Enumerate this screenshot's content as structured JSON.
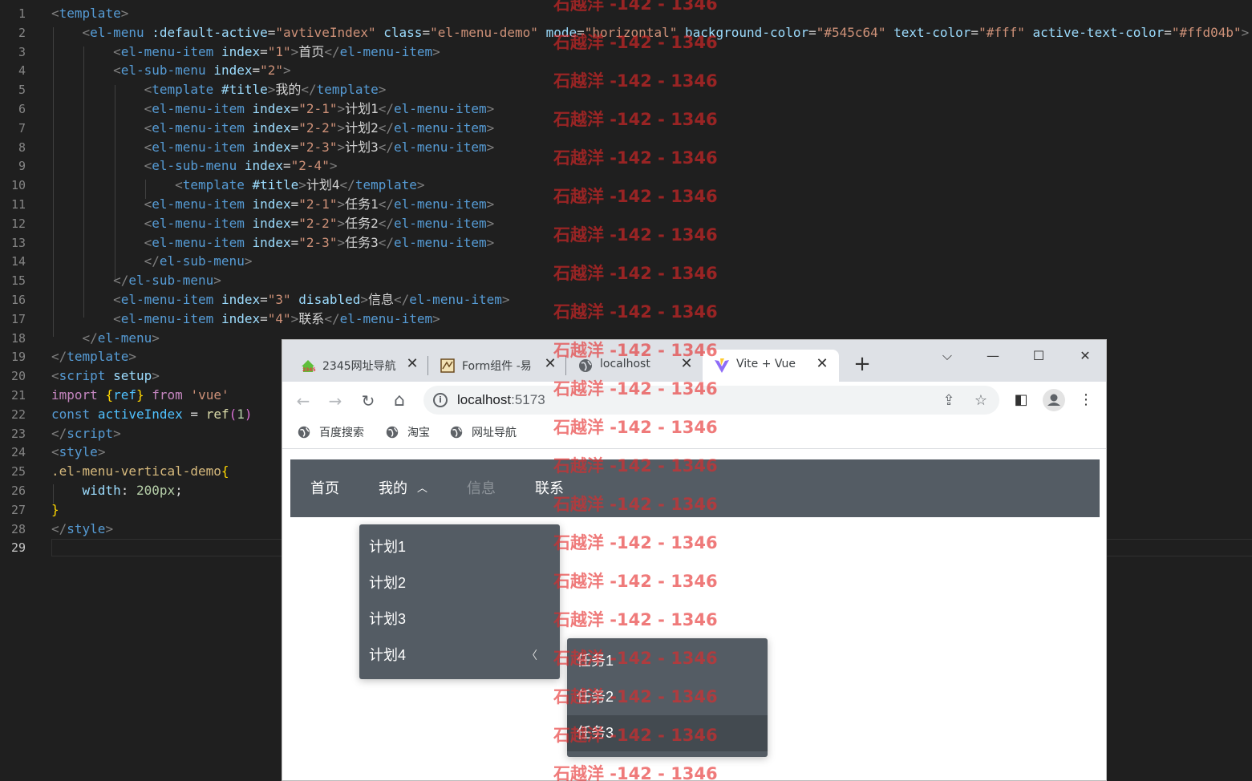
{
  "editor": {
    "lines": [
      [
        [
          "t-br",
          "<"
        ],
        [
          "t-tag",
          "template"
        ],
        [
          "t-br",
          ">"
        ]
      ],
      [
        [
          "t-txt",
          "    "
        ],
        [
          "t-br",
          "<"
        ],
        [
          "t-tag",
          "el-menu"
        ],
        [
          "t-txt",
          " "
        ],
        [
          "t-attr",
          ":default-active"
        ],
        [
          "t-txt",
          "="
        ],
        [
          "t-str",
          "\"avtiveIndex\""
        ],
        [
          "t-txt",
          " "
        ],
        [
          "t-attr",
          "class"
        ],
        [
          "t-txt",
          "="
        ],
        [
          "t-str",
          "\"el-menu-demo\""
        ],
        [
          "t-txt",
          " "
        ],
        [
          "t-attr",
          "mode"
        ],
        [
          "t-txt",
          "="
        ],
        [
          "t-str",
          "\"horizontal\""
        ],
        [
          "t-txt",
          " "
        ],
        [
          "t-attr",
          "background-color"
        ],
        [
          "t-txt",
          "="
        ],
        [
          "t-str",
          "\"#545c64\""
        ],
        [
          "t-txt",
          " "
        ],
        [
          "t-attr",
          "text-color"
        ],
        [
          "t-txt",
          "="
        ],
        [
          "t-str",
          "\"#fff\""
        ],
        [
          "t-txt",
          " "
        ],
        [
          "t-attr",
          "active-text-color"
        ],
        [
          "t-txt",
          "="
        ],
        [
          "t-str",
          "\"#ffd04b\""
        ],
        [
          "t-br",
          ">"
        ]
      ],
      [
        [
          "t-txt",
          "        "
        ],
        [
          "t-br",
          "<"
        ],
        [
          "t-tag",
          "el-menu-item"
        ],
        [
          "t-txt",
          " "
        ],
        [
          "t-attr",
          "index"
        ],
        [
          "t-txt",
          "="
        ],
        [
          "t-str",
          "\"1\""
        ],
        [
          "t-br",
          ">"
        ],
        [
          "t-txt",
          "首页"
        ],
        [
          "t-br",
          "</"
        ],
        [
          "t-tag",
          "el-menu-item"
        ],
        [
          "t-br",
          ">"
        ]
      ],
      [
        [
          "t-txt",
          "        "
        ],
        [
          "t-br",
          "<"
        ],
        [
          "t-tag",
          "el-sub-menu"
        ],
        [
          "t-txt",
          " "
        ],
        [
          "t-attr",
          "index"
        ],
        [
          "t-txt",
          "="
        ],
        [
          "t-str",
          "\"2\""
        ],
        [
          "t-br",
          ">"
        ]
      ],
      [
        [
          "t-txt",
          "            "
        ],
        [
          "t-br",
          "<"
        ],
        [
          "t-tag",
          "template"
        ],
        [
          "t-txt",
          " "
        ],
        [
          "t-attr",
          "#title"
        ],
        [
          "t-br",
          ">"
        ],
        [
          "t-txt",
          "我的"
        ],
        [
          "t-br",
          "</"
        ],
        [
          "t-tag",
          "template"
        ],
        [
          "t-br",
          ">"
        ]
      ],
      [
        [
          "t-txt",
          "            "
        ],
        [
          "t-br",
          "<"
        ],
        [
          "t-tag",
          "el-menu-item"
        ],
        [
          "t-txt",
          " "
        ],
        [
          "t-attr",
          "index"
        ],
        [
          "t-txt",
          "="
        ],
        [
          "t-str",
          "\"2-1\""
        ],
        [
          "t-br",
          ">"
        ],
        [
          "t-txt",
          "计划1"
        ],
        [
          "t-br",
          "</"
        ],
        [
          "t-tag",
          "el-menu-item"
        ],
        [
          "t-br",
          ">"
        ]
      ],
      [
        [
          "t-txt",
          "            "
        ],
        [
          "t-br",
          "<"
        ],
        [
          "t-tag",
          "el-menu-item"
        ],
        [
          "t-txt",
          " "
        ],
        [
          "t-attr",
          "index"
        ],
        [
          "t-txt",
          "="
        ],
        [
          "t-str",
          "\"2-2\""
        ],
        [
          "t-br",
          ">"
        ],
        [
          "t-txt",
          "计划2"
        ],
        [
          "t-br",
          "</"
        ],
        [
          "t-tag",
          "el-menu-item"
        ],
        [
          "t-br",
          ">"
        ]
      ],
      [
        [
          "t-txt",
          "            "
        ],
        [
          "t-br",
          "<"
        ],
        [
          "t-tag",
          "el-menu-item"
        ],
        [
          "t-txt",
          " "
        ],
        [
          "t-attr",
          "index"
        ],
        [
          "t-txt",
          "="
        ],
        [
          "t-str",
          "\"2-3\""
        ],
        [
          "t-br",
          ">"
        ],
        [
          "t-txt",
          "计划3"
        ],
        [
          "t-br",
          "</"
        ],
        [
          "t-tag",
          "el-menu-item"
        ],
        [
          "t-br",
          ">"
        ]
      ],
      [
        [
          "t-txt",
          "            "
        ],
        [
          "t-br",
          "<"
        ],
        [
          "t-tag",
          "el-sub-menu"
        ],
        [
          "t-txt",
          " "
        ],
        [
          "t-attr",
          "index"
        ],
        [
          "t-txt",
          "="
        ],
        [
          "t-str",
          "\"2-4\""
        ],
        [
          "t-br",
          ">"
        ]
      ],
      [
        [
          "t-txt",
          "                "
        ],
        [
          "t-br",
          "<"
        ],
        [
          "t-tag",
          "template"
        ],
        [
          "t-txt",
          " "
        ],
        [
          "t-attr",
          "#title"
        ],
        [
          "t-br",
          ">"
        ],
        [
          "t-txt",
          "计划4"
        ],
        [
          "t-br",
          "</"
        ],
        [
          "t-tag",
          "template"
        ],
        [
          "t-br",
          ">"
        ]
      ],
      [
        [
          "t-txt",
          "            "
        ],
        [
          "t-br",
          "<"
        ],
        [
          "t-tag",
          "el-menu-item"
        ],
        [
          "t-txt",
          " "
        ],
        [
          "t-attr",
          "index"
        ],
        [
          "t-txt",
          "="
        ],
        [
          "t-str",
          "\"2-1\""
        ],
        [
          "t-br",
          ">"
        ],
        [
          "t-txt",
          "任务1"
        ],
        [
          "t-br",
          "</"
        ],
        [
          "t-tag",
          "el-menu-item"
        ],
        [
          "t-br",
          ">"
        ]
      ],
      [
        [
          "t-txt",
          "            "
        ],
        [
          "t-br",
          "<"
        ],
        [
          "t-tag",
          "el-menu-item"
        ],
        [
          "t-txt",
          " "
        ],
        [
          "t-attr",
          "index"
        ],
        [
          "t-txt",
          "="
        ],
        [
          "t-str",
          "\"2-2\""
        ],
        [
          "t-br",
          ">"
        ],
        [
          "t-txt",
          "任务2"
        ],
        [
          "t-br",
          "</"
        ],
        [
          "t-tag",
          "el-menu-item"
        ],
        [
          "t-br",
          ">"
        ]
      ],
      [
        [
          "t-txt",
          "            "
        ],
        [
          "t-br",
          "<"
        ],
        [
          "t-tag",
          "el-menu-item"
        ],
        [
          "t-txt",
          " "
        ],
        [
          "t-attr",
          "index"
        ],
        [
          "t-txt",
          "="
        ],
        [
          "t-str",
          "\"2-3\""
        ],
        [
          "t-br",
          ">"
        ],
        [
          "t-txt",
          "任务3"
        ],
        [
          "t-br",
          "</"
        ],
        [
          "t-tag",
          "el-menu-item"
        ],
        [
          "t-br",
          ">"
        ]
      ],
      [
        [
          "t-txt",
          "            "
        ],
        [
          "t-br",
          "</"
        ],
        [
          "t-tag",
          "el-sub-menu"
        ],
        [
          "t-br",
          ">"
        ]
      ],
      [
        [
          "t-txt",
          "        "
        ],
        [
          "t-br",
          "</"
        ],
        [
          "t-tag",
          "el-sub-menu"
        ],
        [
          "t-br",
          ">"
        ]
      ],
      [
        [
          "t-txt",
          "        "
        ],
        [
          "t-br",
          "<"
        ],
        [
          "t-tag",
          "el-menu-item"
        ],
        [
          "t-txt",
          " "
        ],
        [
          "t-attr",
          "index"
        ],
        [
          "t-txt",
          "="
        ],
        [
          "t-str",
          "\"3\""
        ],
        [
          "t-txt",
          " "
        ],
        [
          "t-attr",
          "disabled"
        ],
        [
          "t-br",
          ">"
        ],
        [
          "t-txt",
          "信息"
        ],
        [
          "t-br",
          "</"
        ],
        [
          "t-tag",
          "el-menu-item"
        ],
        [
          "t-br",
          ">"
        ]
      ],
      [
        [
          "t-txt",
          "        "
        ],
        [
          "t-br",
          "<"
        ],
        [
          "t-tag",
          "el-menu-item"
        ],
        [
          "t-txt",
          " "
        ],
        [
          "t-attr",
          "index"
        ],
        [
          "t-txt",
          "="
        ],
        [
          "t-str",
          "\"4\""
        ],
        [
          "t-br",
          ">"
        ],
        [
          "t-txt",
          "联系"
        ],
        [
          "t-br",
          "</"
        ],
        [
          "t-tag",
          "el-menu-item"
        ],
        [
          "t-br",
          ">"
        ]
      ],
      [
        [
          "t-txt",
          "    "
        ],
        [
          "t-br",
          "</"
        ],
        [
          "t-tag",
          "el-menu"
        ],
        [
          "t-br",
          ">"
        ]
      ],
      [
        [
          "t-br",
          "</"
        ],
        [
          "t-tag",
          "template"
        ],
        [
          "t-br",
          ">"
        ]
      ],
      [
        [
          "t-br",
          "<"
        ],
        [
          "t-tag",
          "script"
        ],
        [
          "t-txt",
          " "
        ],
        [
          "t-attr",
          "setup"
        ],
        [
          "t-br",
          ">"
        ]
      ],
      [
        [
          "t-kw2",
          "import"
        ],
        [
          "t-txt",
          " "
        ],
        [
          "t-brace",
          "{"
        ],
        [
          "t-var",
          "ref"
        ],
        [
          "t-brace",
          "}"
        ],
        [
          "t-txt",
          " "
        ],
        [
          "t-kw2",
          "from"
        ],
        [
          "t-txt",
          " "
        ],
        [
          "t-str",
          "'vue'"
        ]
      ],
      [
        [
          "t-kw",
          "const"
        ],
        [
          "t-txt",
          " "
        ],
        [
          "t-var",
          "activeIndex"
        ],
        [
          "t-txt",
          " = "
        ],
        [
          "t-fn",
          "ref"
        ],
        [
          "t-paren",
          "("
        ],
        [
          "t-num",
          "1"
        ],
        [
          "t-paren",
          ")"
        ]
      ],
      [
        [
          "t-br",
          "</"
        ],
        [
          "t-tag",
          "script"
        ],
        [
          "t-br",
          ">"
        ]
      ],
      [
        [
          "t-br",
          "<"
        ],
        [
          "t-tag",
          "style"
        ],
        [
          "t-br",
          ">"
        ]
      ],
      [
        [
          "t-sel",
          ".el-menu-vertical-demo"
        ],
        [
          "t-brace",
          "{"
        ]
      ],
      [
        [
          "t-txt",
          "    "
        ],
        [
          "t-prop",
          "width"
        ],
        [
          "t-txt",
          ": "
        ],
        [
          "t-num",
          "200px"
        ],
        [
          "t-txt",
          ";"
        ]
      ],
      [
        [
          "t-brace",
          "}"
        ]
      ],
      [
        [
          "t-br",
          "</"
        ],
        [
          "t-tag",
          "style"
        ],
        [
          "t-br",
          ">"
        ]
      ],
      []
    ],
    "current_line": 29
  },
  "browser": {
    "tabs": [
      {
        "title": "2345网址导航",
        "favicon": "2345-house-icon"
      },
      {
        "title": "Form组件 -易",
        "favicon": "form-scroll-icon"
      },
      {
        "title": "localhost",
        "favicon": "globe-icon"
      },
      {
        "title": "Vite + Vue",
        "favicon": "vite-icon",
        "active": true
      }
    ],
    "new_tab": "+",
    "tab_close": "✕",
    "window_controls": {
      "dropdown": "⌵",
      "minimize": "—",
      "maximize": "☐",
      "close": "✕"
    },
    "address": {
      "host": "localhost",
      "port": ":5173"
    },
    "nav": {
      "back": "←",
      "forward": "→",
      "reload": "↻",
      "home": "⌂"
    },
    "actions": {
      "share": "⇪",
      "bookmark": "☆",
      "sidepanel": "◧",
      "menu": "⋮"
    },
    "bookmarks": [
      "百度搜索",
      "淘宝",
      "网址导航"
    ]
  },
  "menu": {
    "background": "#545c64",
    "text_color": "#ffffff",
    "items": [
      {
        "label": "首页"
      },
      {
        "label": "我的",
        "arrow": "︿"
      },
      {
        "label": "信息",
        "disabled": true
      },
      {
        "label": "联系"
      }
    ],
    "submenu": [
      "计划1",
      "计划2",
      "计划3",
      "计划4"
    ],
    "submenu_chevron": "〈",
    "nested": [
      "任务1",
      "任务2",
      "任务3"
    ],
    "hovered_nested": "任务3"
  },
  "watermark": {
    "text": "石越洋 -142 - 1346",
    "color": "#e52828"
  }
}
